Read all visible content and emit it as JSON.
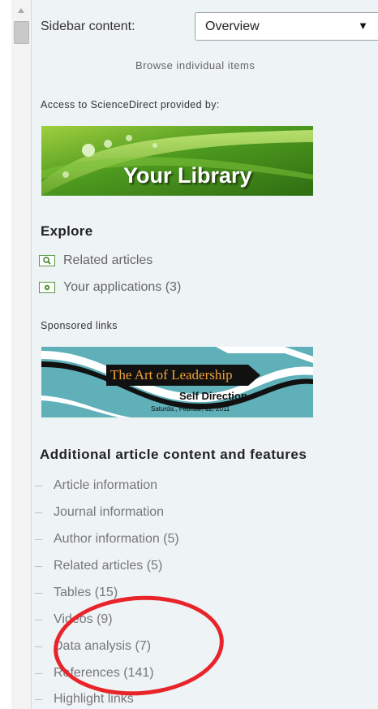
{
  "sidebar": {
    "content_label": "Sidebar content:",
    "select_value": "Overview",
    "browse_link": "Browse individual items",
    "access_text": "Access to ScienceDirect provided by:",
    "library_banner_text": "Your Library"
  },
  "explore": {
    "title": "Explore",
    "items": [
      {
        "label": "Related articles",
        "icon": "search-icon"
      },
      {
        "label": "Your applications (3)",
        "icon": "gear-icon"
      }
    ]
  },
  "sponsored": {
    "label": "Sponsored links",
    "ad_title": "The Art of Leadership",
    "ad_subtitle": "Self Direction",
    "ad_date": "Saturda., Februar, 12, 2011"
  },
  "additional": {
    "title": "Additional article content and features",
    "items": [
      "Article information",
      "Journal information",
      "Author information (5)",
      "Related articles (5)",
      "Tables (15)",
      "Videos (9)",
      "Data analysis (7)",
      "References (141)",
      "Highlight links"
    ]
  },
  "colors": {
    "panel_bg": "#eef3f6",
    "annotation_red": "#e8242a",
    "icon_green": "#5a9a3c"
  }
}
